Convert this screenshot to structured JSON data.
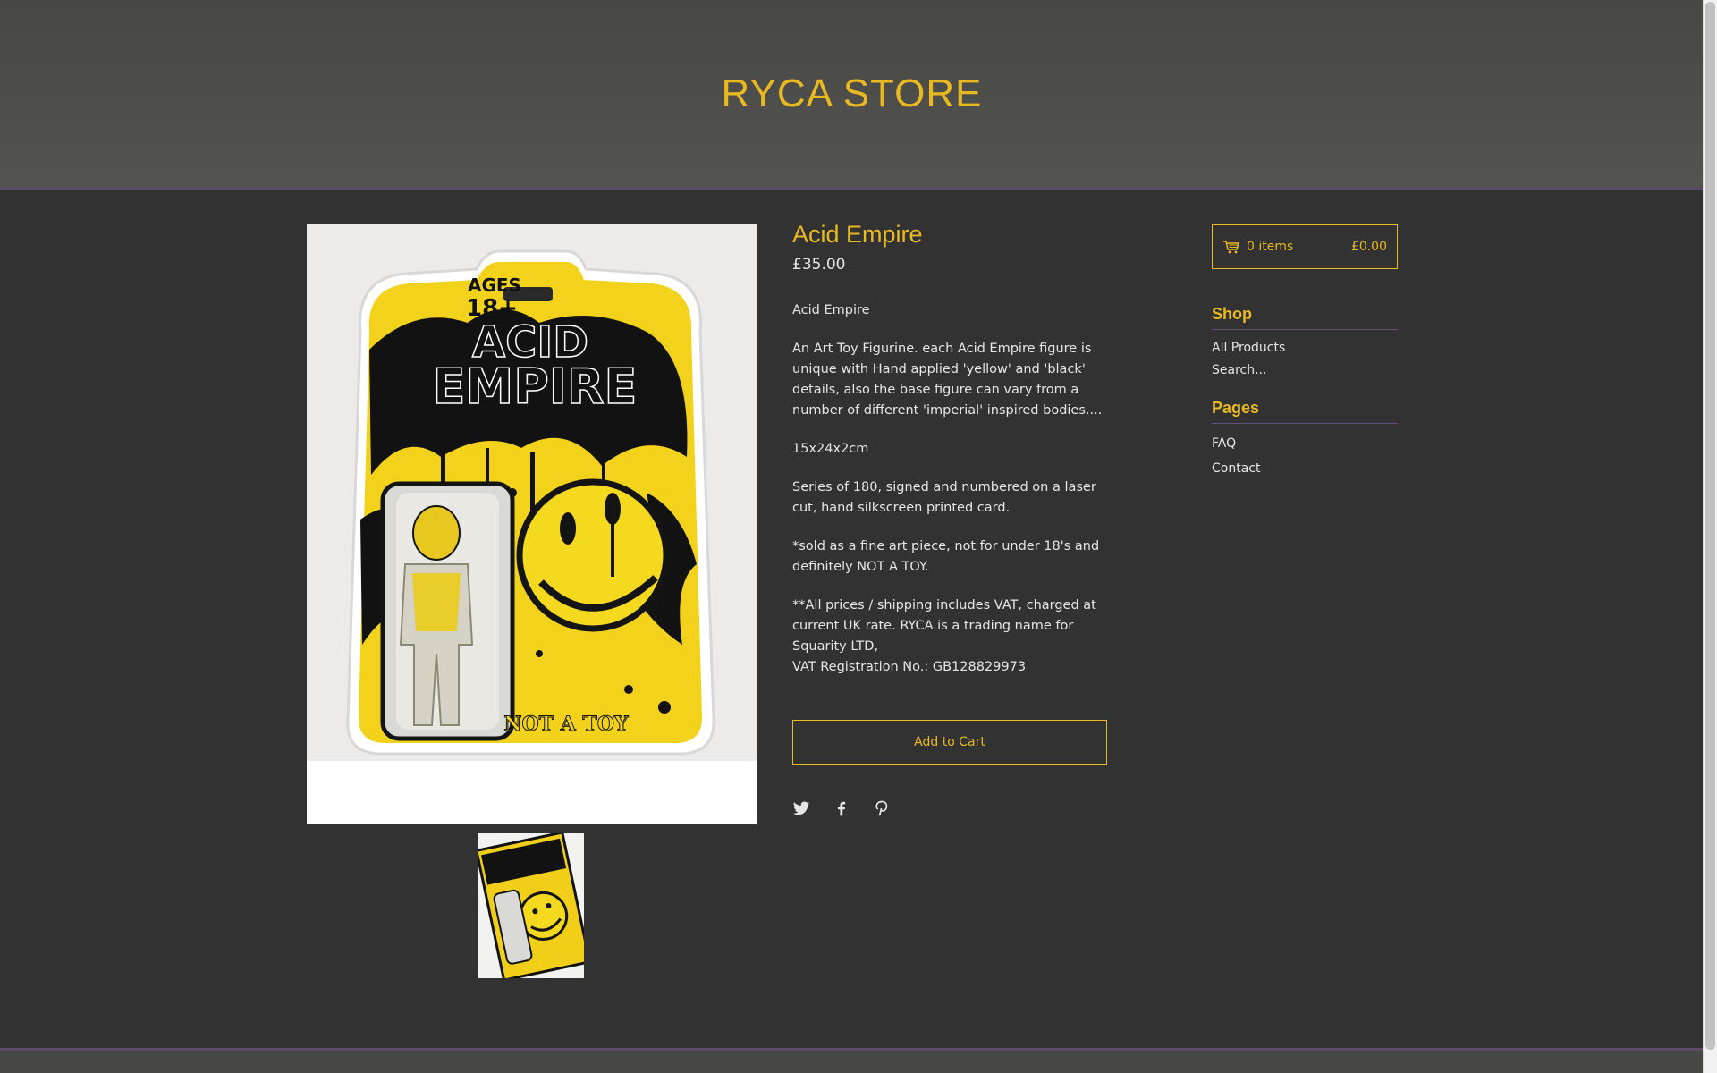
{
  "store": {
    "title": "RYCA STORE"
  },
  "product": {
    "title": "Acid Empire",
    "price": "£35.00",
    "description": [
      "Acid Empire",
      "An Art Toy Figurine. each Acid Empire figure is unique with Hand applied 'yellow' and 'black' details, also the base figure can vary from a number of different 'imperial' inspired bodies....",
      "15x24x2cm",
      "Series of 180, signed and numbered on a laser cut, hand silkscreen printed card.",
      "*sold as a fine art piece, not for under 18's and definitely NOT A TOY.",
      "**All prices / shipping includes VAT, charged at current UK rate. RYCA is a trading name for Squarity LTD,",
      "VAT Registration No.: GB128829973"
    ],
    "add_to_cart_label": "Add to Cart",
    "image_text": {
      "ages": "AGES",
      "age_number": "18+",
      "line1": "ACID",
      "line2": "EMPIRE",
      "footer": "NOT A TOY"
    }
  },
  "share": {
    "icons": [
      "twitter-icon",
      "facebook-icon",
      "pinterest-icon"
    ]
  },
  "cart": {
    "count_label": "0 items",
    "total": "£0.00",
    "icon": "cart-icon"
  },
  "sidebar": {
    "shop_heading": "Shop",
    "shop_links": [
      "All Products",
      "Search..."
    ],
    "pages_heading": "Pages",
    "pages_links": [
      "FAQ",
      "Contact"
    ]
  },
  "colors": {
    "accent": "#e8b921",
    "background": "#323232",
    "header": "#4e4e4c",
    "divider": "#6a4f7d",
    "text": "#e6e6e6"
  }
}
